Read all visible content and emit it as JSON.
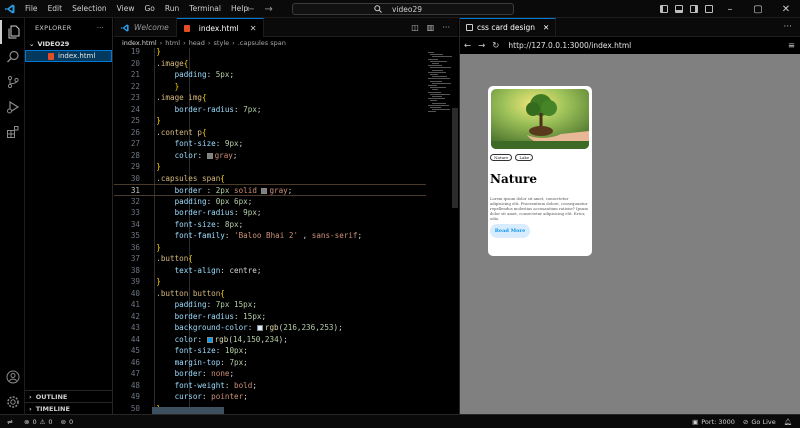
{
  "titlebar": {
    "menu": [
      "File",
      "Edit",
      "Selection",
      "View",
      "Go",
      "Run",
      "Terminal",
      "Help"
    ],
    "search_text": "video29"
  },
  "sidebar": {
    "title": "EXPLORER",
    "more": "···",
    "folder": "VIDEO29",
    "file": "index.html",
    "outline": "OUTLINE",
    "timeline": "TIMELINE"
  },
  "editor": {
    "tabs": [
      {
        "label": "Welcome",
        "active": false
      },
      {
        "label": "index.html",
        "active": true
      }
    ],
    "breadcrumb": [
      "index.html",
      "html",
      "head",
      "style",
      ".capsules span"
    ],
    "lines": [
      {
        "n": "19",
        "segments": [
          [
            "c-br",
            "    }"
          ]
        ]
      },
      {
        "n": "20",
        "segments": [
          [
            "c-sel",
            "    .image"
          ],
          [
            "c-br",
            "{"
          ]
        ]
      },
      {
        "n": "21",
        "segments": [
          [
            "c-prop",
            "        padding"
          ],
          [
            "c-white",
            ": "
          ],
          [
            "c-num",
            "5px"
          ],
          [
            "c-white",
            ";"
          ]
        ]
      },
      {
        "n": "22",
        "segments": [
          [
            "c-br",
            "        }"
          ]
        ]
      },
      {
        "n": "23",
        "segments": [
          [
            "c-sel",
            "    .image img"
          ],
          [
            "c-br",
            "{"
          ]
        ]
      },
      {
        "n": "24",
        "segments": [
          [
            "c-prop",
            "        border-radius"
          ],
          [
            "c-white",
            ": "
          ],
          [
            "c-num",
            "7px"
          ],
          [
            "c-white",
            ";"
          ]
        ]
      },
      {
        "n": "25",
        "segments": [
          [
            "c-br",
            "    }"
          ]
        ]
      },
      {
        "n": "26",
        "segments": [
          [
            "c-sel",
            "    .content p"
          ],
          [
            "c-br",
            "{"
          ]
        ]
      },
      {
        "n": "27",
        "segments": [
          [
            "c-prop",
            "        font-size"
          ],
          [
            "c-white",
            ": "
          ],
          [
            "c-num",
            "9px"
          ],
          [
            "c-white",
            ";"
          ]
        ]
      },
      {
        "n": "28",
        "segments": [
          [
            "c-prop",
            "        color"
          ],
          [
            "c-white",
            ": "
          ],
          [
            "sw:#808080",
            ""
          ],
          [
            "c-val",
            "gray"
          ],
          [
            "c-white",
            ";"
          ]
        ]
      },
      {
        "n": "29",
        "segments": [
          [
            "c-br",
            "    }"
          ]
        ]
      },
      {
        "n": "30",
        "segments": [
          [
            "c-sel",
            "    .capsules span"
          ],
          [
            "c-br",
            "{"
          ]
        ]
      },
      {
        "n": "31",
        "segments": [
          [
            "c-prop",
            "        border "
          ],
          [
            "c-white",
            ": "
          ],
          [
            "c-num",
            "2px "
          ],
          [
            "c-val",
            "solid "
          ],
          [
            "sw:#808080",
            ""
          ],
          [
            "c-val",
            "gray"
          ],
          [
            "c-white",
            ";"
          ]
        ],
        "current": true
      },
      {
        "n": "32",
        "segments": [
          [
            "c-prop",
            "        padding"
          ],
          [
            "c-white",
            ": "
          ],
          [
            "c-num",
            "0px 6px"
          ],
          [
            "c-white",
            ";"
          ]
        ]
      },
      {
        "n": "33",
        "segments": [
          [
            "c-prop",
            "        border-radius"
          ],
          [
            "c-white",
            ": "
          ],
          [
            "c-num",
            "9px"
          ],
          [
            "c-white",
            ";"
          ]
        ]
      },
      {
        "n": "34",
        "segments": [
          [
            "c-prop",
            "        font-size"
          ],
          [
            "c-white",
            ": "
          ],
          [
            "c-num",
            "8px"
          ],
          [
            "c-white",
            ";"
          ]
        ]
      },
      {
        "n": "35",
        "segments": [
          [
            "c-prop",
            "        font-family"
          ],
          [
            "c-white",
            ": "
          ],
          [
            "c-val",
            "'Baloo Bhai 2'"
          ],
          [
            "c-white",
            " , "
          ],
          [
            "c-val",
            "sans-serif"
          ],
          [
            "c-white",
            ";"
          ]
        ]
      },
      {
        "n": "36",
        "segments": [
          [
            "c-br",
            "    }"
          ]
        ]
      },
      {
        "n": "37",
        "segments": [
          [
            "c-sel",
            "    .button"
          ],
          [
            "c-br",
            "{"
          ]
        ]
      },
      {
        "n": "38",
        "segments": [
          [
            "c-prop",
            "        text-align"
          ],
          [
            "c-white",
            ": centre;"
          ]
        ]
      },
      {
        "n": "39",
        "segments": [
          [
            "c-br",
            "    }"
          ]
        ]
      },
      {
        "n": "40",
        "segments": [
          [
            "c-sel",
            "    .button button"
          ],
          [
            "c-br",
            "{"
          ]
        ]
      },
      {
        "n": "41",
        "segments": [
          [
            "c-prop",
            "        padding"
          ],
          [
            "c-white",
            ": "
          ],
          [
            "c-num",
            "7px 15px"
          ],
          [
            "c-white",
            ";"
          ]
        ]
      },
      {
        "n": "42",
        "segments": [
          [
            "c-prop",
            "        border-radius"
          ],
          [
            "c-white",
            ": "
          ],
          [
            "c-num",
            "15px"
          ],
          [
            "c-white",
            ";"
          ]
        ]
      },
      {
        "n": "43",
        "segments": [
          [
            "c-prop",
            "        background-color"
          ],
          [
            "c-white",
            ": "
          ],
          [
            "sw:#d8ecfd",
            ""
          ],
          [
            "c-fn",
            "rgb"
          ],
          [
            "c-white",
            "("
          ],
          [
            "c-num",
            "216"
          ],
          [
            "c-white",
            ","
          ],
          [
            "c-num",
            "236"
          ],
          [
            "c-white",
            ","
          ],
          [
            "c-num",
            "253"
          ],
          [
            "c-white",
            ");"
          ]
        ]
      },
      {
        "n": "44",
        "segments": [
          [
            "c-prop",
            "        color"
          ],
          [
            "c-white",
            ": "
          ],
          [
            "sw:#0e96ea",
            ""
          ],
          [
            "c-fn",
            "rgb"
          ],
          [
            "c-white",
            "("
          ],
          [
            "c-num",
            "14"
          ],
          [
            "c-white",
            ","
          ],
          [
            "c-num",
            "150"
          ],
          [
            "c-white",
            ","
          ],
          [
            "c-num",
            "234"
          ],
          [
            "c-white",
            ");"
          ]
        ]
      },
      {
        "n": "45",
        "segments": [
          [
            "c-prop",
            "        font-size"
          ],
          [
            "c-white",
            ": "
          ],
          [
            "c-num",
            "10px"
          ],
          [
            "c-white",
            ";"
          ]
        ]
      },
      {
        "n": "46",
        "segments": [
          [
            "c-prop",
            "        margin-top"
          ],
          [
            "c-white",
            ": "
          ],
          [
            "c-num",
            "7px"
          ],
          [
            "c-white",
            ";"
          ]
        ]
      },
      {
        "n": "47",
        "segments": [
          [
            "c-prop",
            "        border"
          ],
          [
            "c-white",
            ": "
          ],
          [
            "c-val",
            "none"
          ],
          [
            "c-white",
            ";"
          ]
        ]
      },
      {
        "n": "48",
        "segments": [
          [
            "c-prop",
            "        font-weight"
          ],
          [
            "c-white",
            ": "
          ],
          [
            "c-val",
            "bold"
          ],
          [
            "c-white",
            ";"
          ]
        ]
      },
      {
        "n": "49",
        "segments": [
          [
            "c-prop",
            "        cursor"
          ],
          [
            "c-white",
            ": "
          ],
          [
            "c-val",
            "pointer"
          ],
          [
            "c-white",
            ";"
          ]
        ]
      },
      {
        "n": "50",
        "segments": [
          [
            "c-br",
            "    }"
          ]
        ]
      }
    ]
  },
  "browser": {
    "tab_label": "css card design",
    "url": "http://127.0.0.1:3000/index.html",
    "card": {
      "capsules": [
        "Nature",
        "Lake"
      ],
      "title": "Nature",
      "text": "Lorem ipsum dolor sit amet, consectetur adipisicing elit. Praesentium dolore, consequuntur repellendus molestias accusantium ratione? Ipsum dolor sit amet, consectetur adipisicing elit. Error, odio.",
      "button": "Read More"
    }
  },
  "statusbar": {
    "errors": "0",
    "warnings": "0",
    "ports": "0",
    "port": "Port: 3000",
    "golive": "Go Live"
  },
  "colors": {
    "accent": "#0078d4",
    "button_bg": "#d8ecfd",
    "button_fg": "#0e96ea"
  }
}
